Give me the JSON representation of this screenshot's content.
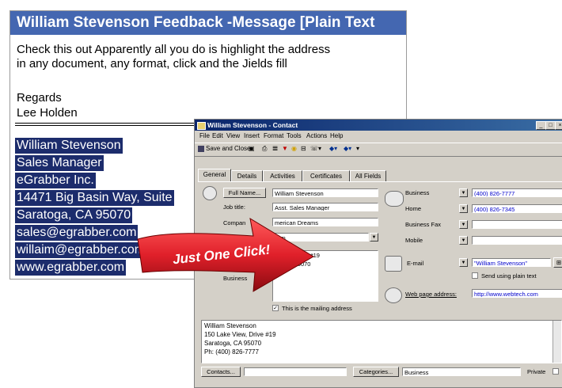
{
  "message": {
    "title": "William Stevenson Feedback -Message [Plain Text",
    "body_line1": "Check this out Apparently all you do is highlight the address",
    "body_line2": "in any document, any format, click and the Jields fill",
    "regards": "Regards",
    "signature": "Lee Holden",
    "selected_lines": [
      "William Stevenson",
      "Sales Manager",
      "eGrabber Inc.",
      "14471 Big Basin Way, Suite",
      "Saratoga, CA 95070",
      "sales@egrabber.com",
      "willaim@egrabber.com",
      "www.egrabber.com"
    ],
    "selection_color": "#1c2c6c",
    "title_bar_color": "#4467b1"
  },
  "arrow": {
    "text": "Just One Click!",
    "color": "#e0202a"
  },
  "contact": {
    "title": "William Stevenson - Contact",
    "menu": [
      "File",
      "Edit",
      "View",
      "Insert",
      "Format",
      "Tools",
      "Actions",
      "Help"
    ],
    "toolbar": {
      "save_close": "Save and Close"
    },
    "tabs": [
      "General",
      "Details",
      "Activities",
      "Certificates",
      "All Fields"
    ],
    "full_name_button": "Full Name...",
    "full_name_value": "William Stevenson",
    "job_title_label": "Job title:",
    "job_title_value": "Asst. Sales Manager",
    "company_label": "Compan",
    "company_value": "merican Dreams",
    "file_as_value": "liam",
    "address_value_1": "e View, drive #19",
    "address_value_2": "ga, CA  95070",
    "address_type": "Business",
    "mailing_address_label": "This is the mailing address",
    "phones": [
      {
        "label": "Business",
        "value": "(400) 826-7777"
      },
      {
        "label": "Home",
        "value": "(400) 826-7345"
      },
      {
        "label": "Business Fax",
        "value": ""
      },
      {
        "label": "Mobile",
        "value": ""
      }
    ],
    "email_label": "E-mail",
    "email_value": "\"William Stevenson\"",
    "plain_text_label": "Send using plain text",
    "web_label": "Web page address:",
    "web_value": "http://www.webtech.com",
    "notes": [
      "William Stevenson",
      "150 Lake View, Drive #19",
      "Saratoga, CA  95070",
      "Ph: (400) 826-7777"
    ],
    "contacts_button": "Contacts...",
    "categories_button": "Categories...",
    "categories_value": "Business",
    "private_label": "Private",
    "title_bar_color": "#0a246a"
  }
}
